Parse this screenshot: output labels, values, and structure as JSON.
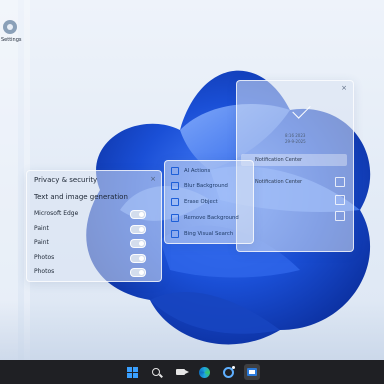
{
  "desktop": {
    "icons": [
      {
        "label": "Settings",
        "icon": "settings-icon"
      }
    ]
  },
  "clock_panel": {
    "date_line1": "8:16 2023",
    "date_line2": "29-9-2025",
    "rows": [
      "Notification Center",
      "Notification Center"
    ]
  },
  "ai_menu": {
    "items": [
      {
        "label": "AI Actions",
        "icon": "sparkle-icon"
      },
      {
        "label": "Blur Background",
        "icon": "blur-icon"
      },
      {
        "label": "Erase Object",
        "icon": "eraser-icon"
      },
      {
        "label": "Remove Background",
        "icon": "remove-bg-icon"
      },
      {
        "label": "Bing Visual Search",
        "icon": "bing-search-icon"
      }
    ]
  },
  "privacy_panel": {
    "title": "Privacy & security",
    "subtitle": "Text and image generation",
    "apps": [
      {
        "name": "Microsoft Edge",
        "enabled": true
      },
      {
        "name": "Paint",
        "enabled": true
      },
      {
        "name": "Paint",
        "enabled": true
      },
      {
        "name": "Photos",
        "enabled": true
      },
      {
        "name": "Photos",
        "enabled": true
      }
    ]
  },
  "taskbar": {
    "items": [
      "windows-start-icon",
      "search-icon",
      "video-camera-icon",
      "edge-icon",
      "ai-app-icon",
      "blue-app-icon"
    ]
  },
  "colors": {
    "accent": "#1e5fd8",
    "taskbar": "#1f2024",
    "bloom": "#1a4fd6"
  }
}
